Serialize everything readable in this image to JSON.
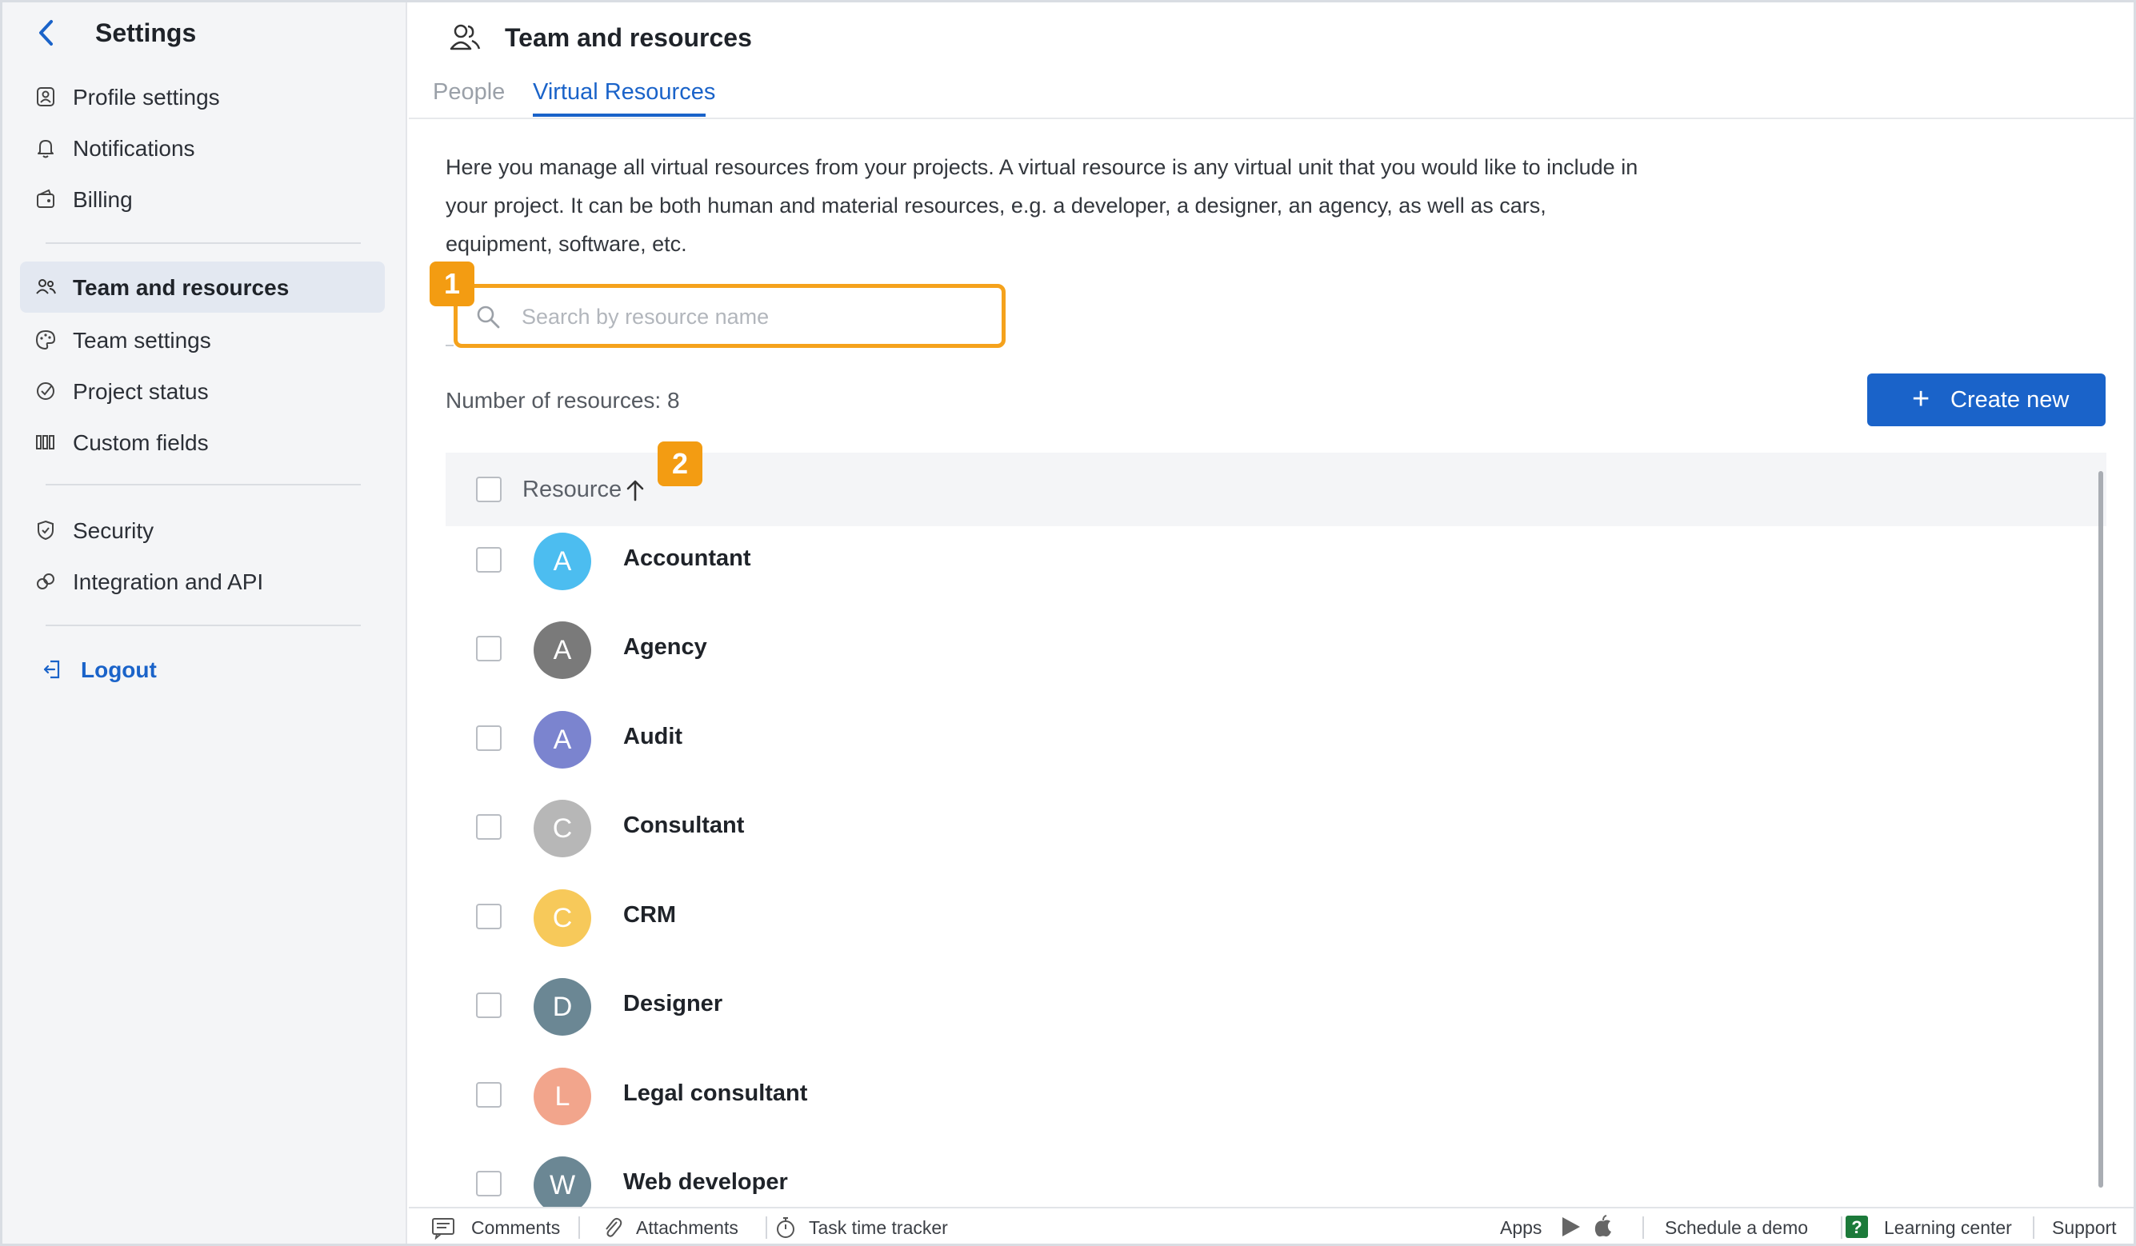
{
  "sidebar": {
    "title": "Settings",
    "items": [
      {
        "label": "Profile settings",
        "icon": "person-card-icon"
      },
      {
        "label": "Notifications",
        "icon": "bell-icon"
      },
      {
        "label": "Billing",
        "icon": "wallet-icon"
      },
      {
        "label": "Team and resources",
        "icon": "team-icon",
        "active": true
      },
      {
        "label": "Team settings",
        "icon": "palette-icon"
      },
      {
        "label": "Project status",
        "icon": "status-icon"
      },
      {
        "label": "Custom fields",
        "icon": "columns-icon"
      },
      {
        "label": "Security",
        "icon": "shield-icon"
      },
      {
        "label": "Integration and API",
        "icon": "link-icon"
      },
      {
        "label": "Logout",
        "icon": "logout-icon"
      }
    ]
  },
  "header": {
    "title": "Team and resources",
    "tabs": [
      {
        "label": "People",
        "active": false
      },
      {
        "label": "Virtual Resources",
        "active": true
      }
    ]
  },
  "main": {
    "description": "Here you manage all virtual resources from your projects. A virtual resource is any virtual unit that you would like to include in your project. It can be both human and material resources, e.g. a developer, a designer, an agency, as well as cars, equipment, software, etc.",
    "search_placeholder": "Search by resource name",
    "count_label": "Number of resources: 8",
    "create_label": "Create new",
    "column_header": "Resource",
    "badges": [
      "1",
      "2"
    ],
    "resources": [
      {
        "initial": "A",
        "name": "Accountant",
        "color": "#4cbdf0"
      },
      {
        "initial": "A",
        "name": "Agency",
        "color": "#7a7a7a"
      },
      {
        "initial": "A",
        "name": "Audit",
        "color": "#7b84cf"
      },
      {
        "initial": "C",
        "name": "Consultant",
        "color": "#b7b7b7"
      },
      {
        "initial": "C",
        "name": "CRM",
        "color": "#f7c95a"
      },
      {
        "initial": "D",
        "name": "Designer",
        "color": "#6b8794"
      },
      {
        "initial": "L",
        "name": "Legal consultant",
        "color": "#f2a58c"
      },
      {
        "initial": "W",
        "name": "Web developer",
        "color": "#6b8794"
      }
    ]
  },
  "footer": {
    "comments": "Comments",
    "attachments": "Attachments",
    "task_time_tracker": "Task time tracker",
    "apps": "Apps",
    "schedule_demo": "Schedule a demo",
    "learning_center": "Learning center",
    "support": "Support"
  },
  "colors": {
    "accent": "#1a63c9",
    "highlight": "#f5a21c"
  }
}
